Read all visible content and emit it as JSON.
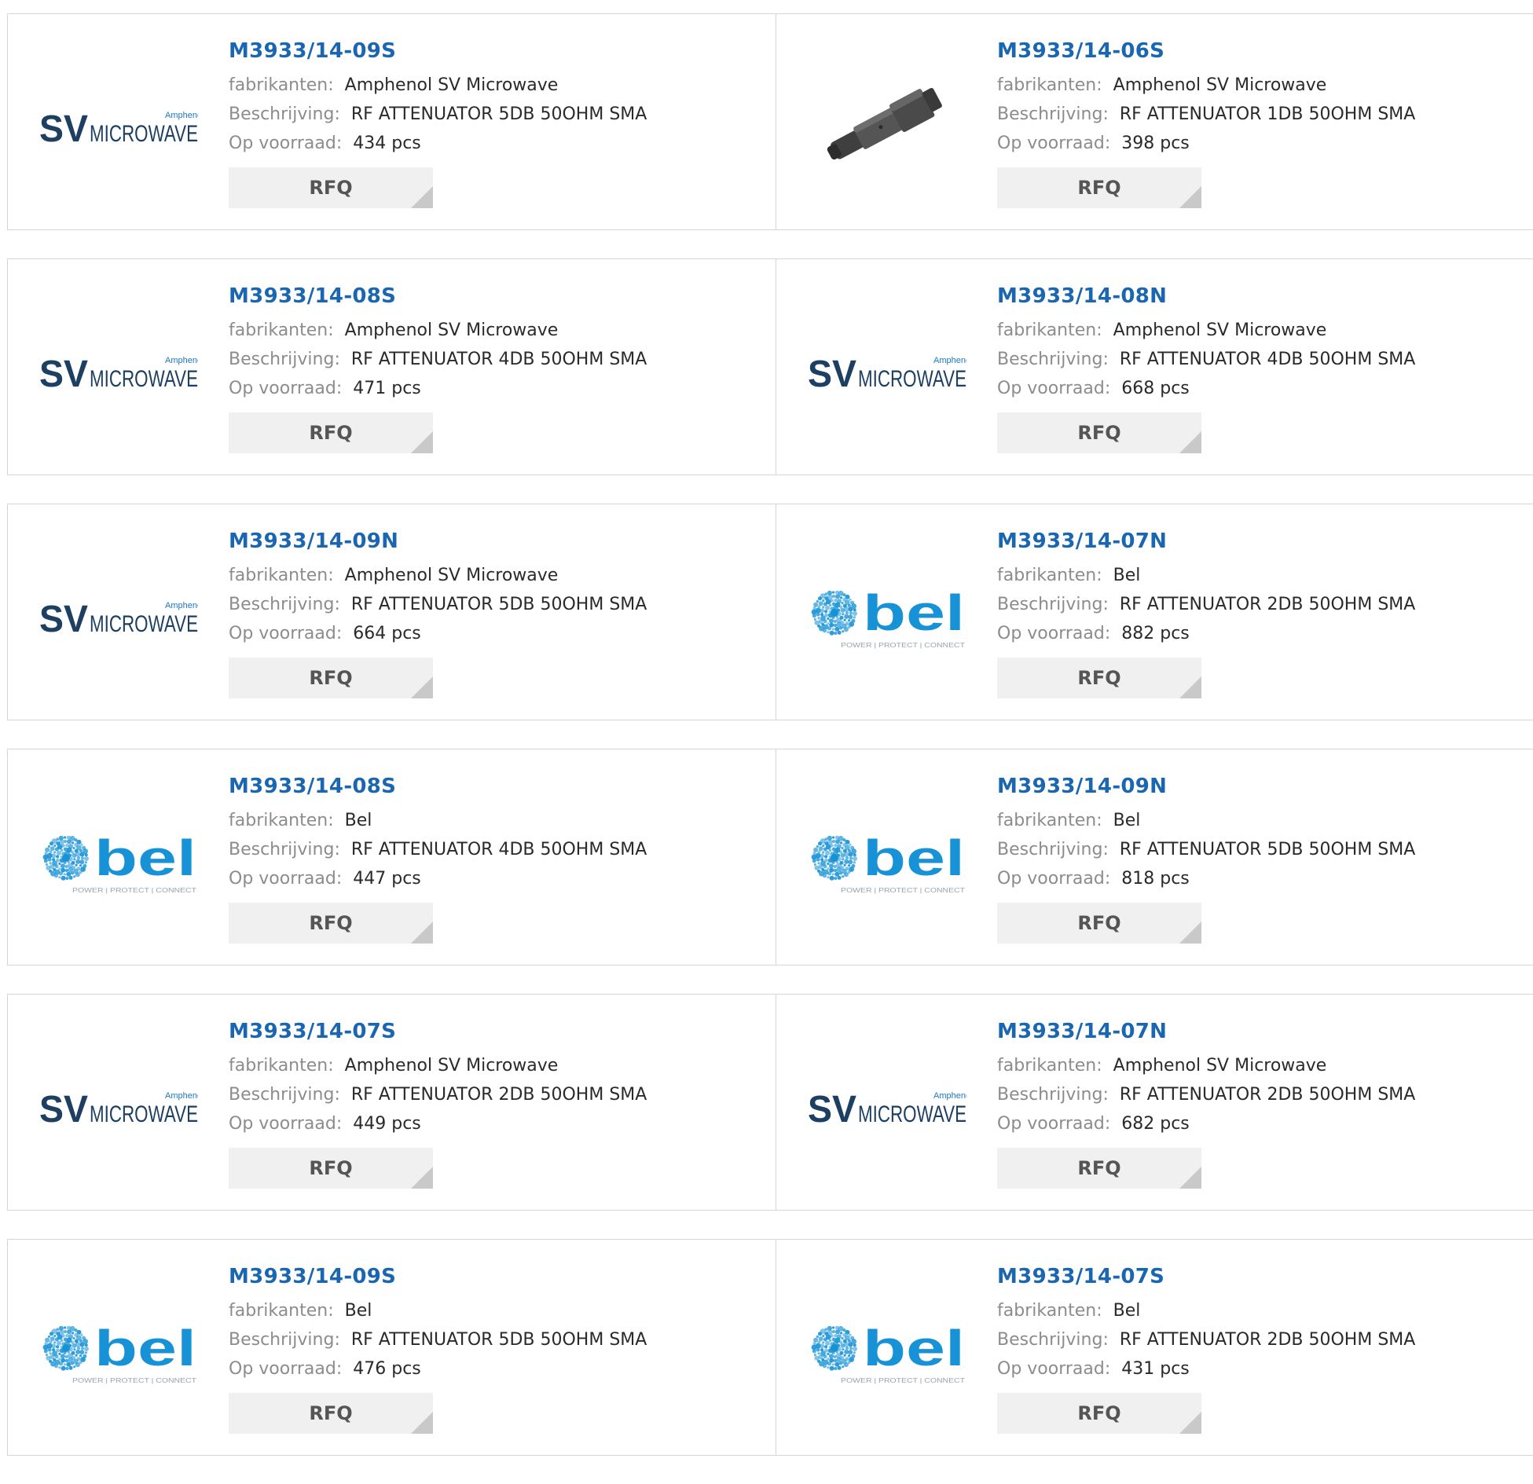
{
  "labels": {
    "manufacturer": "fabrikanten:",
    "description": "Beschrijving:",
    "stock": "Op voorraad:",
    "rfq": "RFQ"
  },
  "colors": {
    "part_link": "#1a66b0",
    "label": "#8c8c8c",
    "border": "#d6d6d6",
    "rfq_bg": "#f0f0f0",
    "sv_navy": "#1d3f62",
    "sv_blue": "#1b78c8",
    "bel_blue": "#1792d6"
  },
  "products": [
    {
      "part": "M3933/14-09S",
      "manufacturer": "Amphenol SV Microwave",
      "description": "RF ATTENUATOR 5DB 50OHM SMA",
      "stock": "434 pcs",
      "image": "sv-microwave-logo"
    },
    {
      "part": "M3933/14-06S",
      "manufacturer": "Amphenol SV Microwave",
      "description": "RF ATTENUATOR 1DB 50OHM SMA",
      "stock": "398 pcs",
      "image": "attenuator-photo"
    },
    {
      "part": "M3933/14-08S",
      "manufacturer": "Amphenol SV Microwave",
      "description": "RF ATTENUATOR 4DB 50OHM SMA",
      "stock": "471 pcs",
      "image": "sv-microwave-logo"
    },
    {
      "part": "M3933/14-08N",
      "manufacturer": "Amphenol SV Microwave",
      "description": "RF ATTENUATOR 4DB 50OHM SMA",
      "stock": "668 pcs",
      "image": "sv-microwave-logo"
    },
    {
      "part": "M3933/14-09N",
      "manufacturer": "Amphenol SV Microwave",
      "description": "RF ATTENUATOR 5DB 50OHM SMA",
      "stock": "664 pcs",
      "image": "sv-microwave-logo"
    },
    {
      "part": "M3933/14-07N",
      "manufacturer": "Bel",
      "description": "RF ATTENUATOR 2DB 50OHM SMA",
      "stock": "882 pcs",
      "image": "bel-logo"
    },
    {
      "part": "M3933/14-08S",
      "manufacturer": "Bel",
      "description": "RF ATTENUATOR 4DB 50OHM SMA",
      "stock": "447 pcs",
      "image": "bel-logo"
    },
    {
      "part": "M3933/14-09N",
      "manufacturer": "Bel",
      "description": "RF ATTENUATOR 5DB 50OHM SMA",
      "stock": "818 pcs",
      "image": "bel-logo"
    },
    {
      "part": "M3933/14-07S",
      "manufacturer": "Amphenol SV Microwave",
      "description": "RF ATTENUATOR 2DB 50OHM SMA",
      "stock": "449 pcs",
      "image": "sv-microwave-logo"
    },
    {
      "part": "M3933/14-07N",
      "manufacturer": "Amphenol SV Microwave",
      "description": "RF ATTENUATOR 2DB 50OHM SMA",
      "stock": "682 pcs",
      "image": "sv-microwave-logo"
    },
    {
      "part": "M3933/14-09S",
      "manufacturer": "Bel",
      "description": "RF ATTENUATOR 5DB 50OHM SMA",
      "stock": "476 pcs",
      "image": "bel-logo"
    },
    {
      "part": "M3933/14-07S",
      "manufacturer": "Bel",
      "description": "RF ATTENUATOR 2DB 50OHM SMA",
      "stock": "431 pcs",
      "image": "bel-logo"
    }
  ],
  "logos": {
    "sv": {
      "mark": "SV",
      "word": "MICROWAVE",
      "brand": "Amphenol"
    },
    "bel": {
      "word": "bel",
      "tagline": "POWER | PROTECT | CONNECT"
    }
  }
}
